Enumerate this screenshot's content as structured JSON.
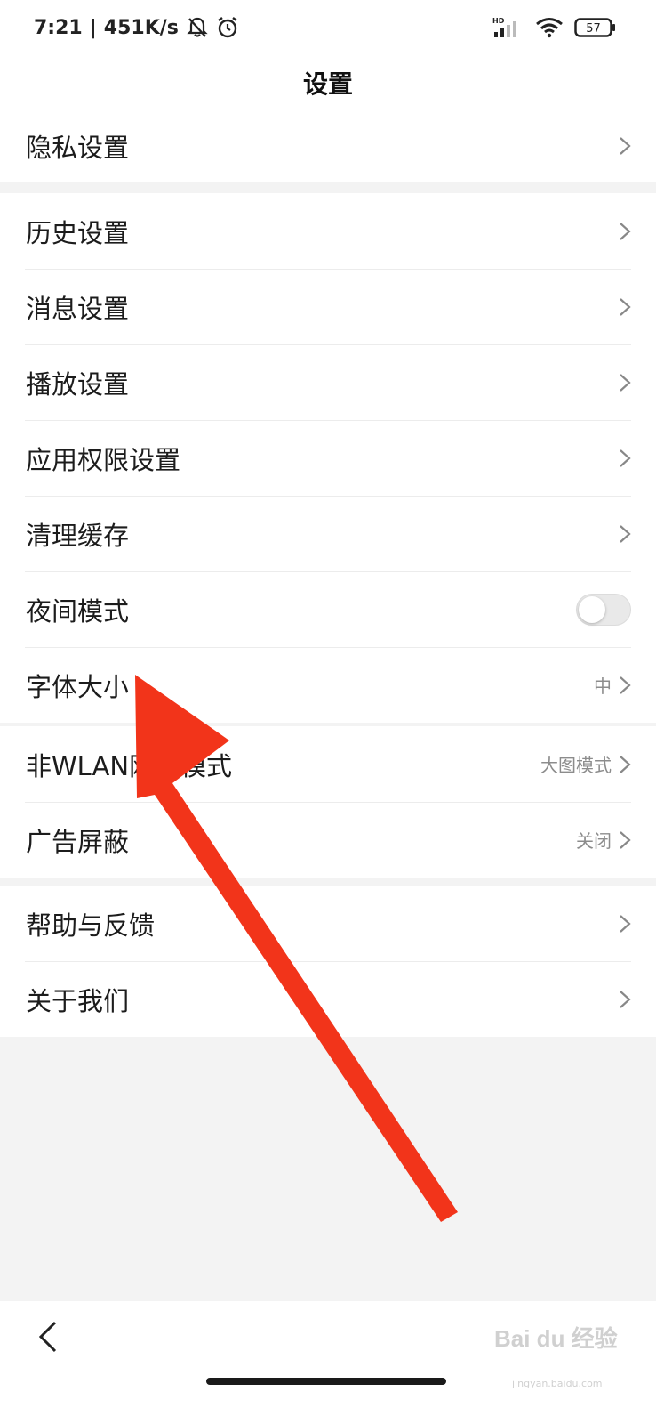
{
  "status_bar": {
    "time": "7:21",
    "separator": "|",
    "speed": "451K/s",
    "icons": [
      "mute-bell-icon",
      "alarm-icon",
      "signal-icon",
      "wifi-icon",
      "battery-icon"
    ],
    "hd_label": "HD",
    "battery_level": "57"
  },
  "header": {
    "title": "设置"
  },
  "groups": [
    {
      "rows": [
        {
          "label": "隐私设置",
          "value": "",
          "control": "chevron"
        }
      ]
    },
    {
      "rows": [
        {
          "label": "历史设置",
          "value": "",
          "control": "chevron"
        },
        {
          "label": "消息设置",
          "value": "",
          "control": "chevron"
        },
        {
          "label": "播放设置",
          "value": "",
          "control": "chevron"
        },
        {
          "label": "应用权限设置",
          "value": "",
          "control": "chevron"
        },
        {
          "label": "清理缓存",
          "value": "",
          "control": "chevron"
        },
        {
          "label": "夜间模式",
          "value": "",
          "control": "toggle",
          "toggle_on": false
        },
        {
          "label": "字体大小",
          "value": "中",
          "control": "chevron"
        }
      ]
    },
    {
      "rows": [
        {
          "label": "非WLAN网络模式",
          "value": "大图模式",
          "control": "chevron"
        },
        {
          "label": "广告屏蔽",
          "value": "关闭",
          "control": "chevron"
        }
      ]
    },
    {
      "rows": [
        {
          "label": "帮助与反馈",
          "value": "",
          "control": "chevron"
        },
        {
          "label": "关于我们",
          "value": "",
          "control": "chevron"
        }
      ]
    }
  ],
  "annotation": {
    "type": "arrow",
    "color": "#f2341a",
    "points_to": "字体大小"
  },
  "watermark": {
    "text": "Bai du 经验",
    "sub": "jingyan.baidu.com"
  },
  "colors": {
    "background": "#f3f3f3",
    "card": "#ffffff",
    "secondary_text": "#8c8c8c",
    "arrow": "#f2341a"
  }
}
